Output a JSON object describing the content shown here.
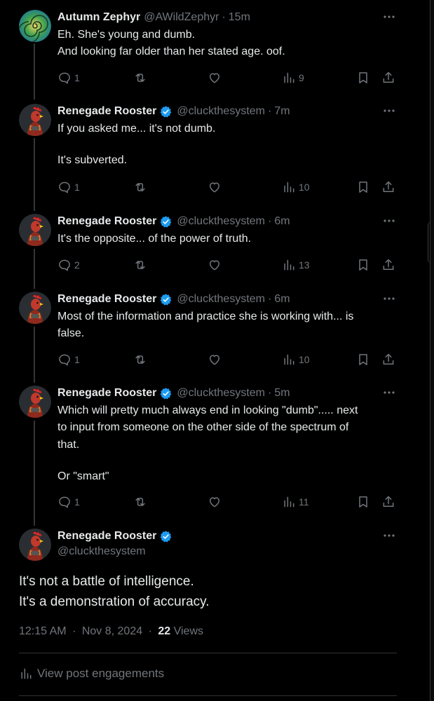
{
  "tweets": [
    {
      "name": "Autumn Zephyr",
      "handle": "@AWildZephyr",
      "time": "15m",
      "verified": false,
      "lines": [
        "Eh. She's young and dumb.",
        "And looking far older than her stated age. oof."
      ],
      "replies": "1",
      "views": "9"
    },
    {
      "name": "Renegade Rooster",
      "handle": "@cluckthesystem",
      "time": "7m",
      "verified": true,
      "lines": [
        "If you asked me... it's not dumb.",
        "",
        "It's subverted."
      ],
      "replies": "1",
      "views": "10"
    },
    {
      "name": "Renegade Rooster",
      "handle": "@cluckthesystem",
      "time": "6m",
      "verified": true,
      "lines": [
        "It's the opposite... of the power of truth."
      ],
      "replies": "2",
      "views": "13"
    },
    {
      "name": "Renegade Rooster",
      "handle": "@cluckthesystem",
      "time": "6m",
      "verified": true,
      "lines": [
        "Most of the information and practice she is working with... is",
        "false."
      ],
      "replies": "1",
      "views": "10"
    },
    {
      "name": "Renegade Rooster",
      "handle": "@cluckthesystem",
      "time": "5m",
      "verified": true,
      "lines": [
        "Which will pretty much always end in looking \"dumb\"..... next",
        "to input from someone on the other side of the spectrum of",
        "that.",
        "",
        "Or \"smart\""
      ],
      "replies": "1",
      "views": "11"
    }
  ],
  "main_post": {
    "name": "Renegade Rooster",
    "handle": "@cluckthesystem",
    "lines": [
      "It's not a battle of intelligence.",
      "It's a demonstration of accuracy."
    ],
    "time": "12:15 AM",
    "date": "Nov 8, 2024",
    "views_count": "22",
    "views_label": "Views",
    "meta_sep": "·",
    "engagements_label": "View post engagements"
  },
  "ui": {
    "sep": "·",
    "accent": "#1d9bf0",
    "muted": "#71767b",
    "text": "#e7e9ea",
    "background": "#000000",
    "icons": [
      "reply-icon",
      "repost-icon",
      "like-icon",
      "views-icon",
      "bookmark-icon",
      "share-icon",
      "more-icon",
      "verified-badge-icon"
    ]
  }
}
